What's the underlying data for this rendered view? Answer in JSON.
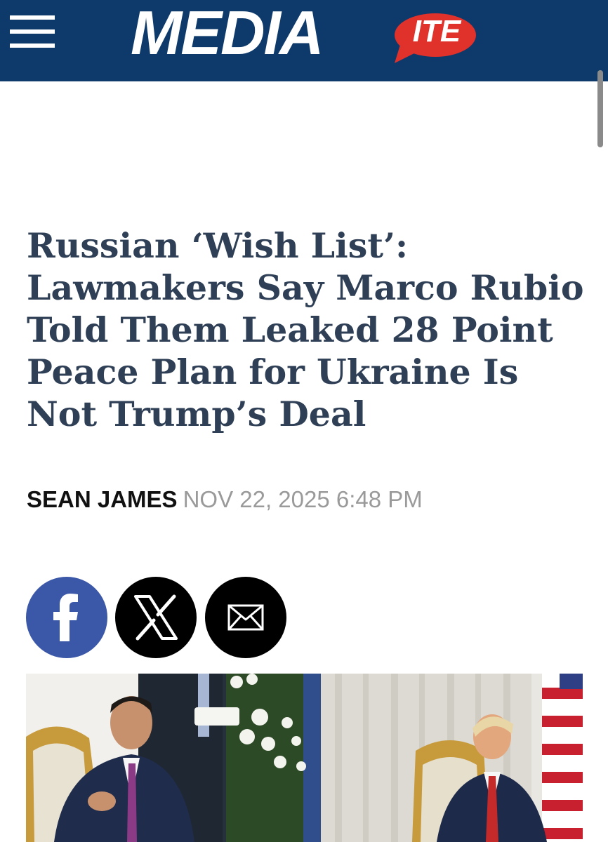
{
  "header": {
    "brand_main": "MEDIA",
    "brand_badge": "ITE",
    "brand_color": "#0d3a6b",
    "badge_color": "#e0312b",
    "menu_icon": "hamburger-menu-icon"
  },
  "article": {
    "headline": "Russian ‘Wish List’: Lawmakers Say Marco Rubio Told Them Leaked 28 Point Peace Plan for Ukraine Is Not Trump’s Deal",
    "author": "SEAN JAMES",
    "date": "NOV 22, 2025 6:48 PM"
  },
  "share": {
    "buttons": [
      {
        "name": "facebook",
        "icon": "facebook-icon",
        "color": "#3b57a7"
      },
      {
        "name": "x",
        "icon": "x-logo-icon",
        "color": "#000000"
      },
      {
        "name": "email",
        "icon": "envelope-icon",
        "color": "#000000"
      }
    ]
  },
  "photo": {
    "subject": "Marco Rubio and Donald Trump seated in gilded chairs with flowers and U.S. flag"
  }
}
